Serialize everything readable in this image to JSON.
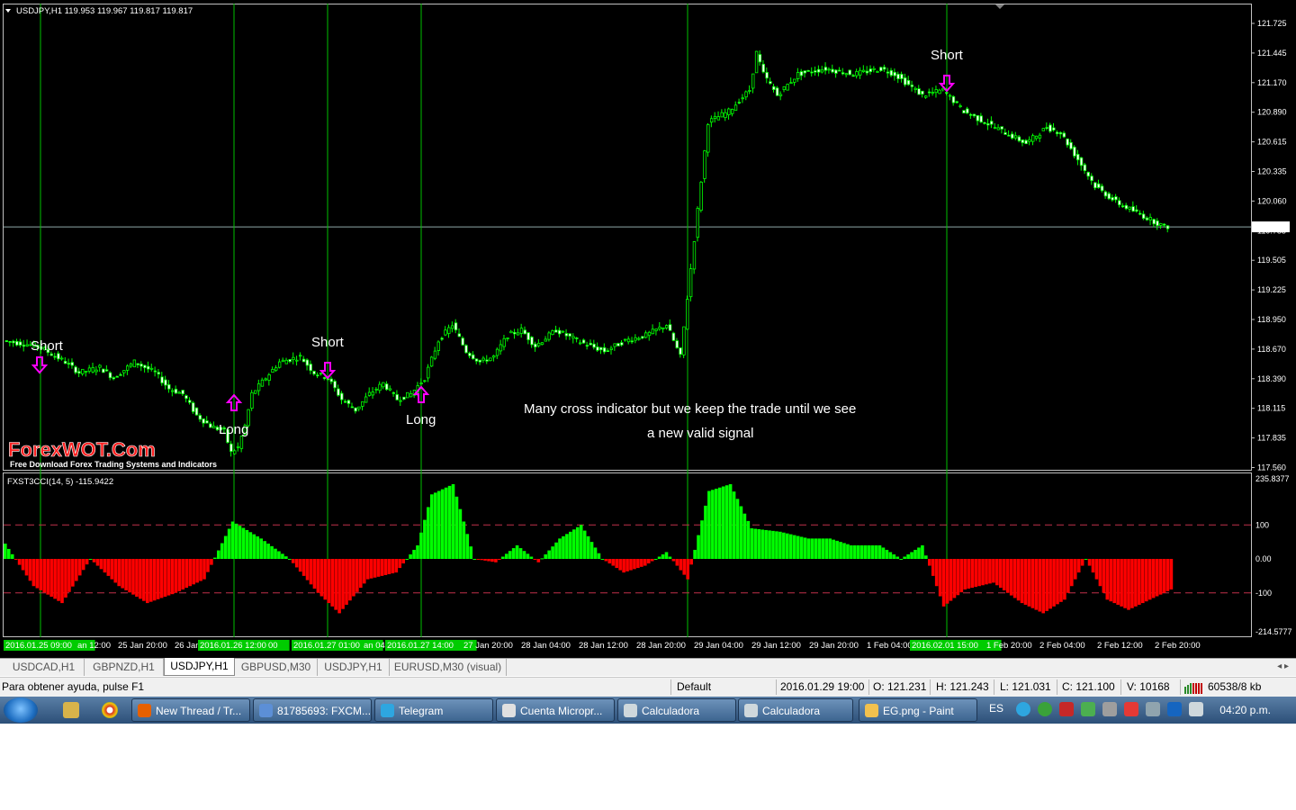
{
  "chart_header": "USDJPY,H1  119.953 119.967 119.817 119.817",
  "indicator_header": "FXST3CCI(14, 5) -115.9422",
  "price_axis": [
    "121.725",
    "121.445",
    "121.170",
    "120.890",
    "120.615",
    "120.335",
    "120.060",
    "119.785",
    "119.505",
    "119.225",
    "118.950",
    "118.670",
    "118.390",
    "118.115",
    "117.835",
    "117.560"
  ],
  "current_price": "119.817",
  "indicator_axis": [
    "235.8377",
    "100",
    "0.00",
    "-100",
    "-214.5777"
  ],
  "time_labels": [
    "2016.01.25 09:00",
    "an 12:00",
    "25 Jan 20:00",
    "26 Jan",
    "2016.01.26 12:00",
    "00",
    "2016.01.27 01:00",
    "an 04",
    "2016.01.27 14:00",
    "27 Jan 20:00",
    "28 Jan 04:00",
    "28 Jan 12:00",
    "28 Jan 20:00",
    "29 Jan 04:00",
    "29 Jan 12:00",
    "29 Jan 20:00",
    "1 Feb 04:00",
    "2016.02.01 15:00",
    "1 Feb 20:00",
    "2 Feb 04:00",
    "2 Feb 12:00",
    "2 Feb 20:00"
  ],
  "annotations": {
    "short1": "Short",
    "long1": "Long",
    "short2": "Short",
    "long2": "Long",
    "short3": "Short",
    "note_line1": "Many cross indicator but we keep the trade until we see",
    "note_line2": "a new valid signal"
  },
  "watermark": {
    "title": "ForexWOT.Com",
    "subtitle": "Free Download Forex Trading Systems and Indicators"
  },
  "tabs": [
    "USDCAD,H1",
    "GBPNZD,H1",
    "USDJPY,H1",
    "GBPUSD,M30",
    "USDJPY,H1",
    "EURUSD,M30 (visual)"
  ],
  "tab_scroll": "◂ ▸",
  "status": {
    "help": "Para obtener ayuda, pulse F1",
    "profile": "Default",
    "datetime": "2016.01.29 19:00",
    "open": "O: 121.231",
    "high": "H: 121.243",
    "low": "L: 121.031",
    "close": "C: 121.100",
    "volume": "V: 10168",
    "traffic": "60538/8 kb"
  },
  "taskbar": {
    "windows": [
      "New Thread / Tr...",
      "81785693: FXCM...",
      "Telegram",
      "Cuenta Micropr...",
      "Calculadora",
      "Calculadora",
      "EG.png - Paint"
    ],
    "lang": "ES",
    "clock": "04:20 p.m."
  },
  "colors": {
    "bull": "#00ff00",
    "signal_arrow": "#ff00ff",
    "indicator_positive": "#00ff00",
    "indicator_negative": "#ff0000",
    "level_line": "#c0304a",
    "vline": "#00c000"
  },
  "chart_data": {
    "type": "candlestick",
    "symbol": "USDJPY",
    "timeframe": "H1",
    "ylim": [
      117.56,
      121.725
    ],
    "price_path": [
      [
        0,
        118.75
      ],
      [
        10,
        118.7
      ],
      [
        18,
        118.55
      ],
      [
        22,
        118.45
      ],
      [
        28,
        118.5
      ],
      [
        32,
        118.4
      ],
      [
        38,
        118.55
      ],
      [
        44,
        118.45
      ],
      [
        48,
        118.3
      ],
      [
        52,
        118.25
      ],
      [
        56,
        118.05
      ],
      [
        60,
        117.95
      ],
      [
        64,
        117.9
      ],
      [
        66,
        117.7
      ],
      [
        68,
        117.75
      ],
      [
        70,
        117.95
      ],
      [
        72,
        118.25
      ],
      [
        76,
        118.4
      ],
      [
        80,
        118.55
      ],
      [
        86,
        118.6
      ],
      [
        90,
        118.45
      ],
      [
        94,
        118.4
      ],
      [
        98,
        118.2
      ],
      [
        102,
        118.1
      ],
      [
        106,
        118.25
      ],
      [
        110,
        118.35
      ],
      [
        114,
        118.2
      ],
      [
        118,
        118.25
      ],
      [
        122,
        118.4
      ],
      [
        126,
        118.75
      ],
      [
        130,
        118.9
      ],
      [
        134,
        118.65
      ],
      [
        138,
        118.55
      ],
      [
        142,
        118.6
      ],
      [
        146,
        118.8
      ],
      [
        150,
        118.85
      ],
      [
        154,
        118.7
      ],
      [
        160,
        118.85
      ],
      [
        166,
        118.75
      ],
      [
        170,
        118.7
      ],
      [
        174,
        118.65
      ],
      [
        180,
        118.75
      ],
      [
        186,
        118.8
      ],
      [
        192,
        118.9
      ],
      [
        196,
        118.6
      ],
      [
        200,
        119.7
      ],
      [
        204,
        120.8
      ],
      [
        210,
        120.9
      ],
      [
        216,
        121.1
      ],
      [
        218,
        121.45
      ],
      [
        220,
        121.25
      ],
      [
        224,
        121.05
      ],
      [
        230,
        121.25
      ],
      [
        238,
        121.3
      ],
      [
        246,
        121.25
      ],
      [
        254,
        121.3
      ],
      [
        258,
        121.25
      ],
      [
        262,
        121.15
      ],
      [
        266,
        121.05
      ],
      [
        272,
        121.1
      ],
      [
        278,
        120.9
      ],
      [
        284,
        120.8
      ],
      [
        290,
        120.7
      ],
      [
        296,
        120.6
      ],
      [
        302,
        120.75
      ],
      [
        306,
        120.7
      ],
      [
        310,
        120.5
      ],
      [
        316,
        120.2
      ],
      [
        322,
        120.05
      ],
      [
        328,
        119.95
      ],
      [
        336,
        119.82
      ]
    ],
    "cci_series": [
      [
        0,
        45
      ],
      [
        8,
        -80
      ],
      [
        16,
        -130
      ],
      [
        24,
        0
      ],
      [
        32,
        -80
      ],
      [
        40,
        -130
      ],
      [
        48,
        -100
      ],
      [
        56,
        -60
      ],
      [
        64,
        110
      ],
      [
        72,
        60
      ],
      [
        80,
        0
      ],
      [
        88,
        -100
      ],
      [
        94,
        -160
      ],
      [
        102,
        -60
      ],
      [
        110,
        -40
      ],
      [
        116,
        40
      ],
      [
        120,
        190
      ],
      [
        126,
        220
      ],
      [
        132,
        0
      ],
      [
        138,
        -10
      ],
      [
        144,
        40
      ],
      [
        150,
        -10
      ],
      [
        156,
        60
      ],
      [
        162,
        100
      ],
      [
        168,
        0
      ],
      [
        174,
        -40
      ],
      [
        180,
        -20
      ],
      [
        186,
        20
      ],
      [
        192,
        -60
      ],
      [
        198,
        200
      ],
      [
        204,
        220
      ],
      [
        210,
        90
      ],
      [
        218,
        80
      ],
      [
        226,
        60
      ],
      [
        232,
        60
      ],
      [
        238,
        40
      ],
      [
        246,
        40
      ],
      [
        252,
        0
      ],
      [
        258,
        40
      ],
      [
        264,
        -140
      ],
      [
        270,
        -90
      ],
      [
        278,
        -70
      ],
      [
        286,
        -130
      ],
      [
        292,
        -160
      ],
      [
        298,
        -120
      ],
      [
        304,
        0
      ],
      [
        310,
        -120
      ],
      [
        316,
        -150
      ],
      [
        322,
        -120
      ],
      [
        328,
        -90
      ]
    ]
  }
}
